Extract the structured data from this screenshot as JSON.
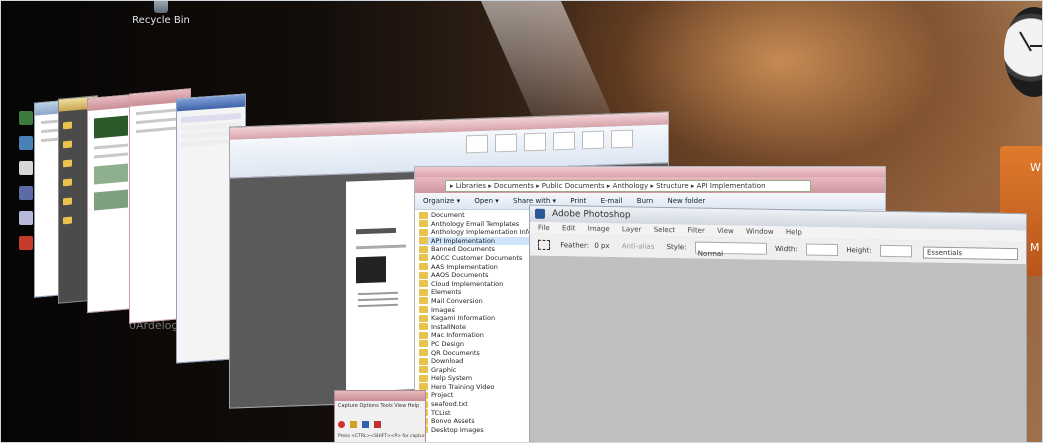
{
  "desktop": {
    "recycle_bin_label": "Recycle Bin",
    "watermark": "0Ardelog..."
  },
  "photoshop": {
    "title": "Adobe Photoshop",
    "menu": [
      "File",
      "Edit",
      "Image",
      "Layer",
      "Select",
      "Filter",
      "View",
      "Window",
      "Help"
    ],
    "feather_label": "Feather:",
    "feather_value": "0 px",
    "anti_alias_label": "Anti-alias",
    "style_label": "Style:",
    "style_value": "Normal",
    "width_label": "Width:",
    "height_label": "Height:",
    "workspace_value": "Essentials"
  },
  "explorer": {
    "address": "▸ Libraries ▸ Documents ▸ Public Documents ▸ Anthology ▸ Structure ▸ API Implementation",
    "toolbar": [
      "Organize ▾",
      "Open ▾",
      "Share with ▾",
      "Print",
      "E-mail",
      "Burn",
      "New folder"
    ],
    "tree": [
      "Document",
      "Anthology Email Templates",
      "Anthology Implementation Info",
      "API Implementation",
      "Banned Documents",
      "AOCC Customer Documents",
      "AAS Implementation",
      "AAOS Documents",
      "Cloud Implementation",
      "Elements",
      "Mail Conversion",
      "Images",
      "Kagami Information",
      "InstallNote",
      "Mac Information",
      "PC Design",
      "QR Documents",
      "Download",
      "Graphic",
      "Help System",
      "Hero Training Video",
      "Project",
      "seafood.txt",
      "TCList",
      "Bonvo Assets",
      "Desktop Images"
    ],
    "selected_index": 3
  },
  "snagit": {
    "menu": [
      "Capture",
      "Options",
      "Tools",
      "View",
      "Help"
    ],
    "status": "Press <CTRL><SHIFT><P> for capture"
  },
  "colors": {
    "accent": "#2b5797",
    "title_pink": "#d8a3ab",
    "folder": "#e8c34d"
  }
}
